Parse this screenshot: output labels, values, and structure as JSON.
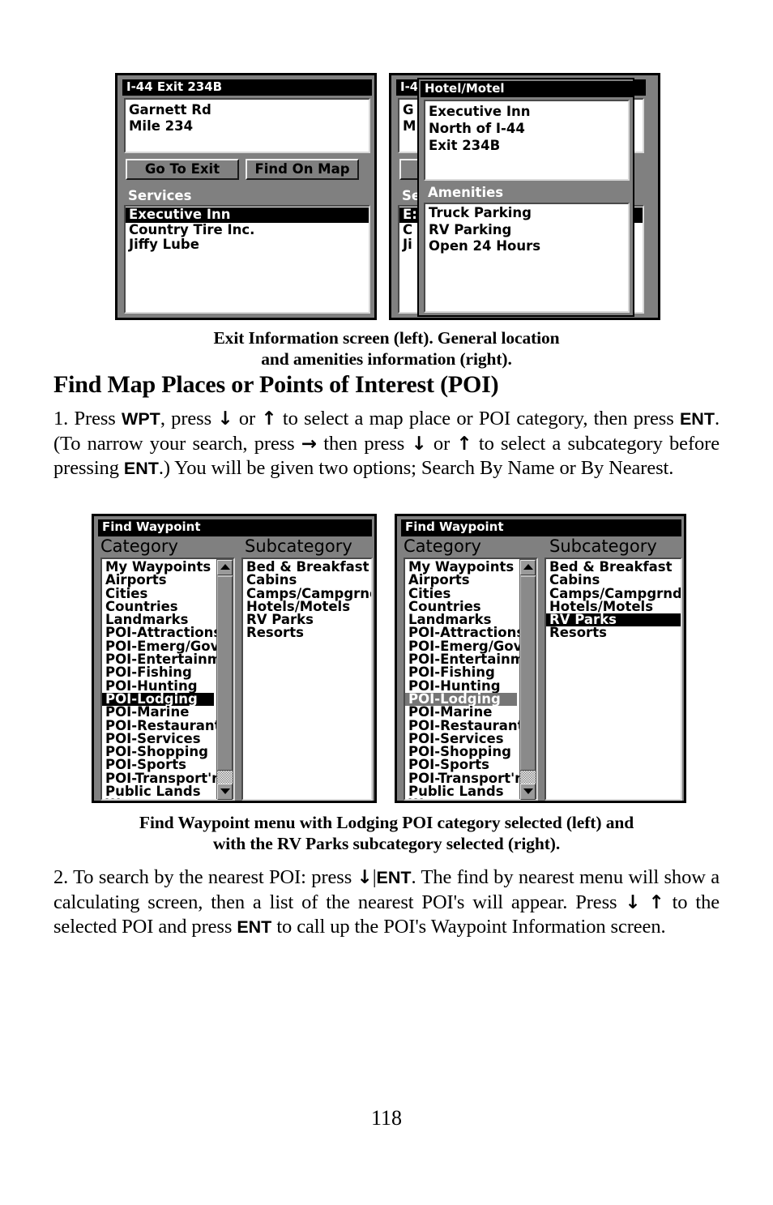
{
  "page": {
    "number": "118"
  },
  "figure1": {
    "caption_line1": "Exit Information screen (left). General location",
    "caption_line2": "and amenities information (right).",
    "left_screen": {
      "title": "I-44 Exit 234B",
      "info_lines": [
        "Garnett Rd",
        "Mile 234"
      ],
      "buttons": {
        "goto": "Go To Exit",
        "findonmap": "Find On Map"
      },
      "services_header": "Services",
      "services": [
        {
          "label": "Executive Inn",
          "selected": true
        },
        {
          "label": "Country Tire Inc.",
          "selected": false
        },
        {
          "label": "Jiffy Lube",
          "selected": false
        }
      ]
    },
    "right_screen": {
      "background_title_fragment": "I-4",
      "background_info_fragments": [
        "G",
        "M"
      ],
      "background_services_fragment": "Se",
      "background_service_fragments": [
        "E:",
        "C",
        "Ji"
      ],
      "popup": {
        "title": "Hotel/Motel",
        "info_lines": [
          "Executive Inn",
          "North of I-44",
          "Exit 234B"
        ],
        "amenities_header": "Amenities",
        "amenities": [
          "Truck Parking",
          "RV Parking",
          "Open 24 Hours"
        ]
      }
    }
  },
  "section": {
    "heading": "Find Map Places or Points of Interest (POI)"
  },
  "step1": {
    "parts": [
      {
        "type": "text",
        "value": "1. Press "
      },
      {
        "type": "key",
        "value": "WPT"
      },
      {
        "type": "text",
        "value": ", press "
      },
      {
        "type": "arrow",
        "value": "↓"
      },
      {
        "type": "text",
        "value": " or "
      },
      {
        "type": "arrow",
        "value": "↑"
      },
      {
        "type": "text",
        "value": " to select a map place or POI category, then press "
      },
      {
        "type": "key",
        "value": "ENT"
      },
      {
        "type": "text",
        "value": ". (To narrow your search, press "
      },
      {
        "type": "arrow",
        "value": "→"
      },
      {
        "type": "text",
        "value": " then press "
      },
      {
        "type": "arrow",
        "value": "↓"
      },
      {
        "type": "text",
        "value": " or "
      },
      {
        "type": "arrow",
        "value": "↑"
      },
      {
        "type": "text",
        "value": " to select a subcategory before pressing "
      },
      {
        "type": "key",
        "value": "ENT"
      },
      {
        "type": "text",
        "value": ".) You will be given two options; Search By Name or By Nearest."
      }
    ]
  },
  "figure2": {
    "caption_line1": "Find Waypoint menu with Lodging POI category selected (left) and",
    "caption_line2": "with the RV Parks subcategory selected (right).",
    "title": "Find Waypoint",
    "column_headers": {
      "category": "Category",
      "subcategory": "Subcategory"
    },
    "categories": [
      "My Waypoints",
      "Airports",
      "Cities",
      "Countries",
      "Landmarks",
      "POI-Attractions",
      "POI-Emerg/Gov't",
      "POI-Entertainmnt",
      "POI-Fishing",
      "POI-Hunting",
      "POI-Lodging",
      "POI-Marine",
      "POI-Restaurants",
      "POI-Services",
      "POI-Shopping",
      "POI-Sports",
      "POI-Transport'n",
      "Public Lands",
      "Waters"
    ],
    "subcategories": [
      "Bed & Breakfast",
      "Cabins",
      "Camps/Campgrnd",
      "Hotels/Motels",
      "RV Parks",
      "Resorts"
    ],
    "left_screen": {
      "selected_category": "POI-Lodging",
      "selected_category_style": "black",
      "selected_subcategory": null
    },
    "right_screen": {
      "selected_category": "POI-Lodging",
      "selected_category_style": "grey",
      "selected_subcategory": "RV Parks",
      "selected_subcategory_style": "black"
    }
  },
  "step2": {
    "parts": [
      {
        "type": "text",
        "value": "2. To search by the nearest POI: press "
      },
      {
        "type": "arrow",
        "value": "↓"
      },
      {
        "type": "text",
        "value": "|"
      },
      {
        "type": "key",
        "value": "ENT"
      },
      {
        "type": "text",
        "value": ". The find by nearest menu will show a calculating screen, then a list of the nearest POI's will appear. Press "
      },
      {
        "type": "arrow",
        "value": "↓"
      },
      {
        "type": "text",
        "value": " "
      },
      {
        "type": "arrow",
        "value": "↑"
      },
      {
        "type": "text",
        "value": " to the selected POI and press "
      },
      {
        "type": "key",
        "value": "ENT"
      },
      {
        "type": "text",
        "value": " to call up the POI's Waypoint Information screen."
      }
    ]
  },
  "colors": {
    "screen_bg": "#808080",
    "selection_black": "#000000",
    "selection_grey": "#767676",
    "panel_white": "#ffffff"
  }
}
